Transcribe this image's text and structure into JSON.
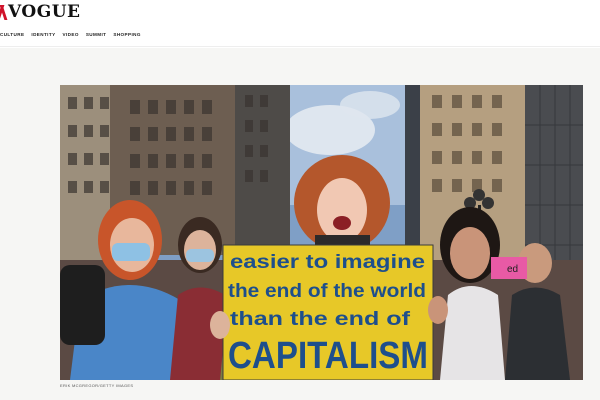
{
  "header": {
    "logo_text": "VOGUE",
    "nav": [
      "CULTURE",
      "IDENTITY",
      "VIDEO",
      "SUMMIT",
      "SHOPPING"
    ]
  },
  "article": {
    "photo": {
      "sign_lines": [
        "easier to imagine",
        "the end of the world",
        "than the end of",
        "CAPITALISM"
      ],
      "small_sign": "ed"
    },
    "credit": "ERIK MCGREGOR/GETTY IMAGES"
  },
  "colors": {
    "brand_red": "#d0122a",
    "sign_yellow": "#e7c828",
    "sign_text": "#1e4f8c"
  }
}
